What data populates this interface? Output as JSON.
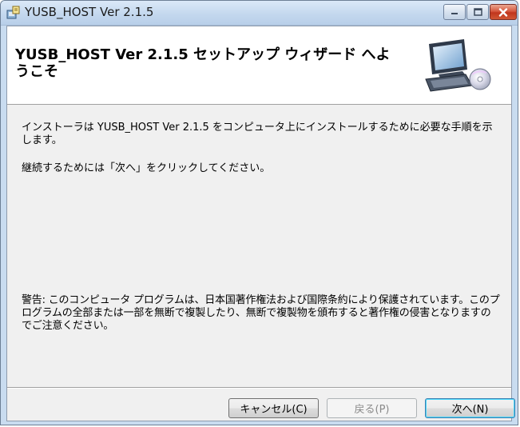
{
  "window": {
    "title": "YUSB_HOST Ver 2.1.5",
    "icons": [
      "installer-icon",
      "minimize-icon",
      "maximize-icon",
      "close-icon"
    ]
  },
  "banner": {
    "title": "YUSB_HOST Ver 2.1.5 セットアップ ウィザード へようこそ",
    "logo_icon": "computer-setup-icon"
  },
  "content": {
    "intro": "インストーラは YUSB_HOST Ver 2.1.5 をコンピュータ上にインストールするために必要な手順を示します。",
    "continue_instruction": "継続するためには「次へ」をクリックしてください。",
    "warning": "警告: このコンピュータ プログラムは、日本国著作権法および国際条約により保護されています。このプログラムの全部または一部を無断で複製したり、無断で複製物を頒布すると著作権の侵害となりますのでご注意ください。"
  },
  "buttons": {
    "cancel": "キャンセル(C)",
    "back": "戻る(P)",
    "next": "次へ(N)"
  },
  "colors": {
    "frame": "#c9dcf0",
    "close_button": "#c1351d",
    "dialog_bg": "#f0f0f0",
    "default_button_border": "#3c7fb1"
  }
}
